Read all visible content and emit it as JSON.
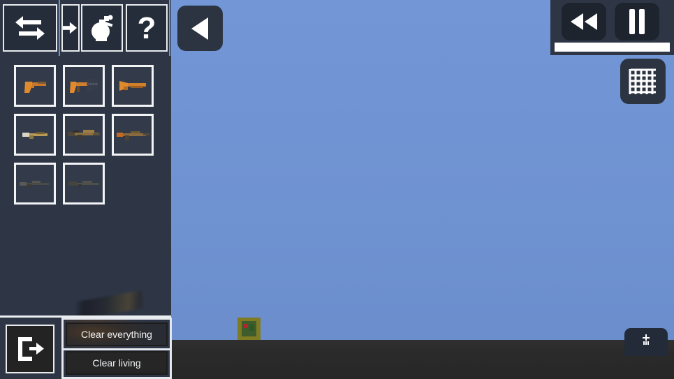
{
  "app": {
    "title": "Weapon Sandbox Editor",
    "sky_color": "#7296d6",
    "ground_color": "#2b2b2b",
    "panel_color": "#2e3646",
    "accent_color": "#ffffff"
  },
  "toolbar": {
    "items": [
      {
        "id": "swap",
        "icon": "swap-arrows-icon",
        "label": "Swap"
      },
      {
        "id": "next",
        "icon": "arrow-right-icon",
        "label": "Next"
      },
      {
        "id": "grenade",
        "icon": "grenade-icon",
        "label": "Grenade"
      },
      {
        "id": "help",
        "icon": "question-mark-icon",
        "label": "Help"
      }
    ]
  },
  "inventory": {
    "title": "Weapons",
    "columns": 3,
    "slots": [
      {
        "index": 1,
        "name": "Pistol",
        "icon": "pistol-icon",
        "tint": "#d8862c"
      },
      {
        "index": 2,
        "name": "Submachine Gun",
        "icon": "smg-icon",
        "tint": "#d8862c"
      },
      {
        "index": 3,
        "name": "Sawed-off Shotgun",
        "icon": "shotgun-icon",
        "tint": "#d8862c"
      },
      {
        "index": 4,
        "name": "Carbine",
        "icon": "carbine-icon",
        "tint": "#b59a55"
      },
      {
        "index": 5,
        "name": "Assault Rifle",
        "icon": "assault-rifle-icon",
        "tint": "#8a6b3e"
      },
      {
        "index": 6,
        "name": "Battle Rifle",
        "icon": "battle-rifle-icon",
        "tint": "#8a6b3e"
      },
      {
        "index": 7,
        "name": "Marksman Rifle",
        "icon": "marksman-rifle-icon",
        "tint": "#4a4a48"
      },
      {
        "index": 8,
        "name": "Sniper Rifle",
        "icon": "sniper-rifle-icon",
        "tint": "#4a4a48"
      }
    ]
  },
  "sidebar_actions": {
    "exit_label": "Exit",
    "exit_icon": "exit-door-icon",
    "clear_everything_label": "Clear everything",
    "clear_living_label": "Clear living"
  },
  "collapse": {
    "label": "Collapse panel",
    "icon": "triangle-left-icon"
  },
  "playback": {
    "rewind_label": "Rewind",
    "rewind_icon": "rewind-double-triangle-icon",
    "pause_label": "Pause",
    "pause_icon": "pause-bars-icon",
    "progress_percent": 100,
    "progress_color": "#ffffff"
  },
  "grid_toggle": {
    "label": "Toggle grid snap",
    "icon": "grid-icon",
    "enabled": true
  },
  "scene": {
    "object_label": "Crate",
    "object_color": "#7e7b22",
    "bottom_right_button_label": "Spawn",
    "bottom_right_button_icon": "anchor-icon"
  }
}
